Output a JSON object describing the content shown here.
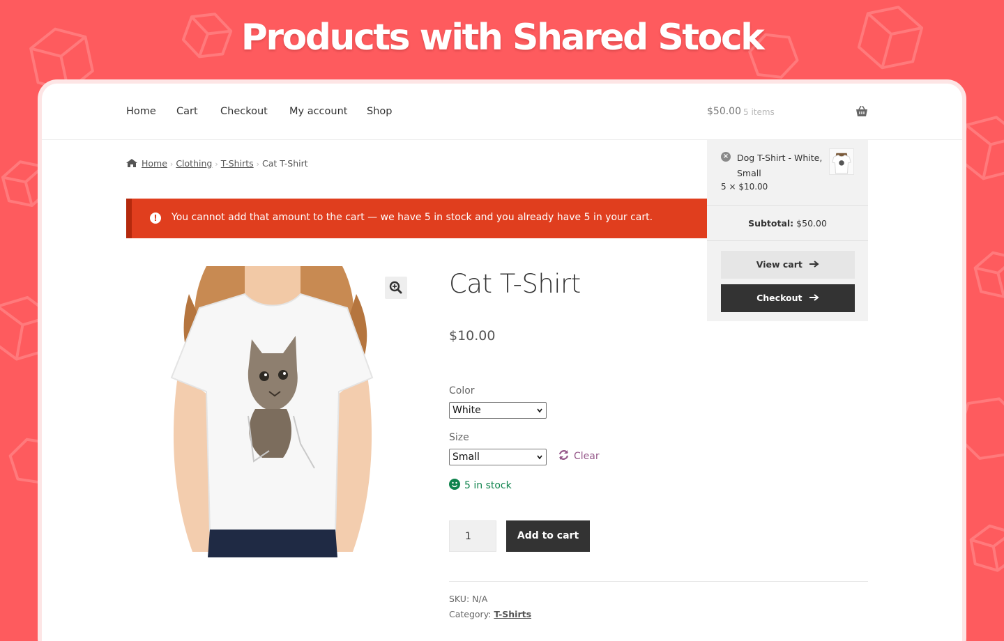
{
  "banner": {
    "title": "Products with Shared Stock"
  },
  "nav": {
    "items": [
      "Home",
      "Cart",
      "Checkout",
      "My account",
      "Shop"
    ],
    "cart_total": "$50.00",
    "cart_count": "5 items"
  },
  "breadcrumb": {
    "home": "Home",
    "clothing": "Clothing",
    "tshirts": "T-Shirts",
    "current": "Cat T-Shirt"
  },
  "notice": {
    "message": "You cannot add that amount to the cart — we have 5 in stock and you already have 5 in your cart."
  },
  "mini_cart": {
    "item_name": "Dog T-Shirt - White, Small",
    "item_qty_price": "5 × $10.00",
    "subtotal_label": "Subtotal:",
    "subtotal_value": "$50.00",
    "view_cart": "View cart",
    "checkout": "Checkout"
  },
  "product": {
    "title": "Cat T-Shirt",
    "price": "$10.00",
    "color_label": "Color",
    "color_value": "White",
    "size_label": "Size",
    "size_value": "Small",
    "clear": "Clear",
    "stock": "5 in stock",
    "quantity": "1",
    "add_to_cart": "Add to cart",
    "sku_label": "SKU:",
    "sku_value": "N/A",
    "category_label": "Category:",
    "category_value": "T-Shirts"
  },
  "colors": {
    "background": "#fe5b5e",
    "notice": "#e03e1e",
    "stock": "#0f834d",
    "clear_link": "#96588a",
    "dark_button": "#333333"
  },
  "icons": [
    "box-pattern-icon",
    "basket-icon",
    "home-icon",
    "error-icon",
    "remove-icon",
    "arrow-right-icon",
    "zoom-icon",
    "refresh-icon",
    "smiley-icon",
    "chevron-down-icon"
  ]
}
